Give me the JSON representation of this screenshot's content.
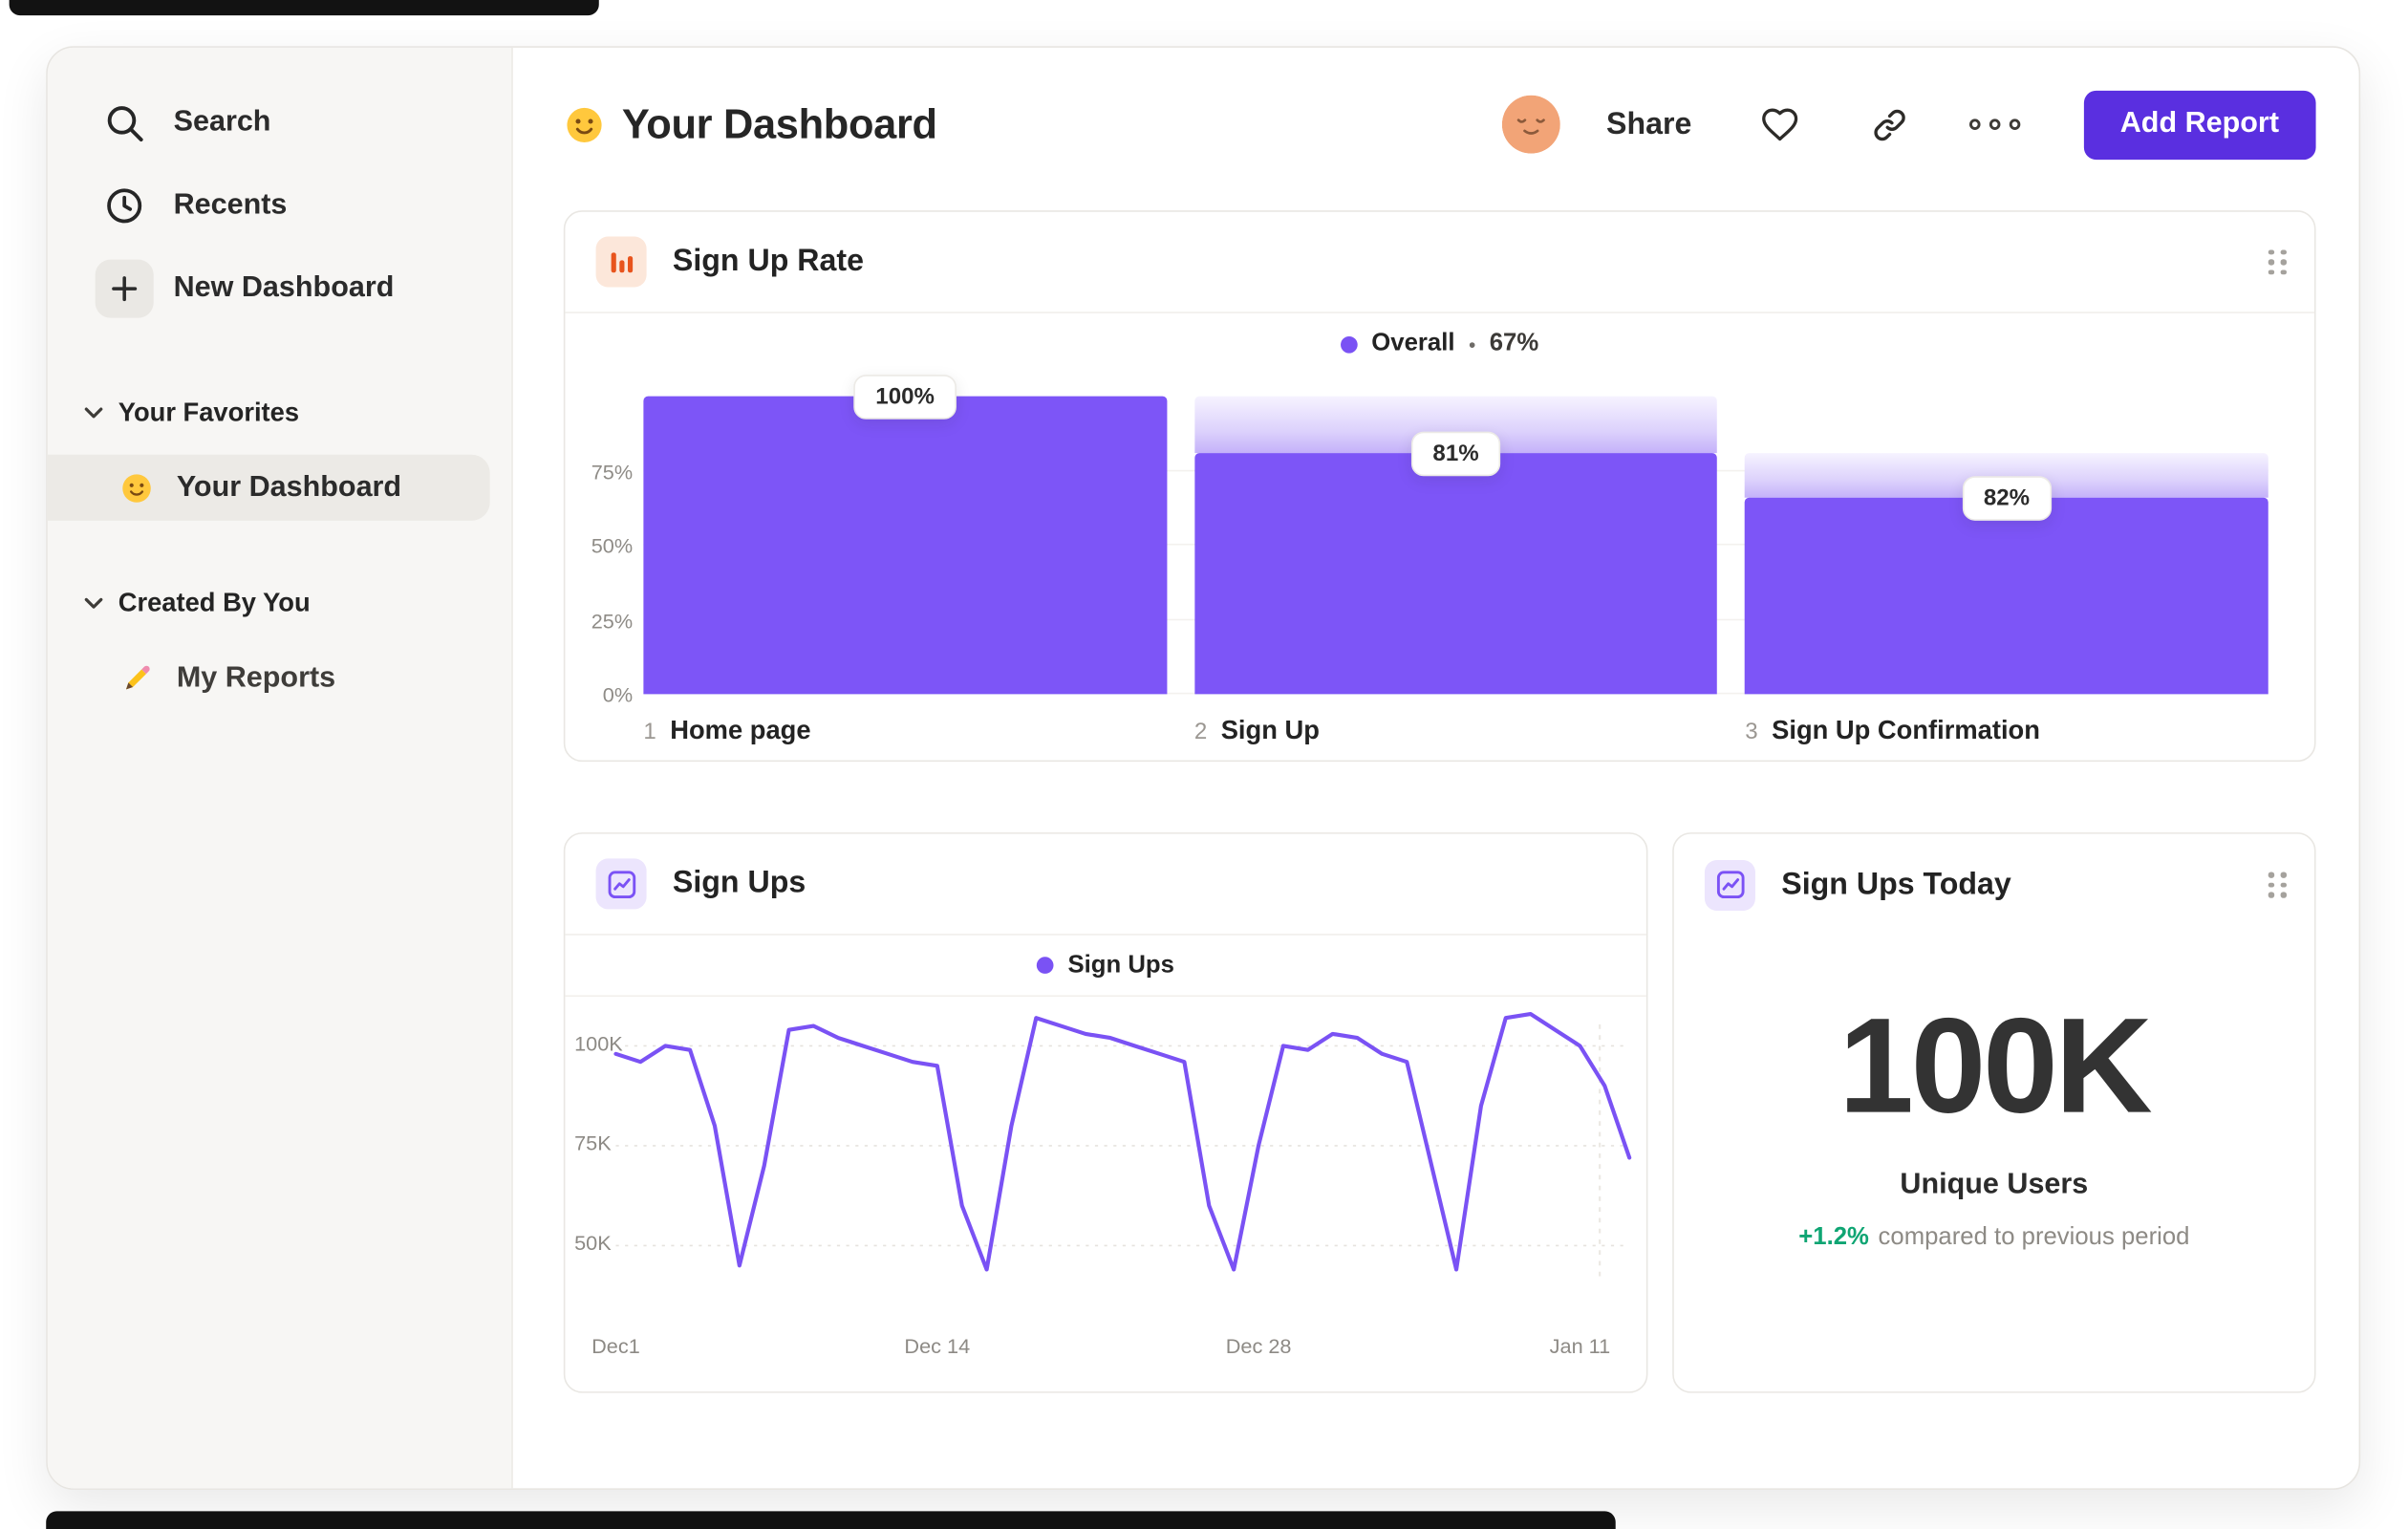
{
  "colors": {
    "accent": "#7A52F4",
    "bar_fill": "#7D55F7",
    "button": "#5A2FE0",
    "positive": "#0FA573",
    "icon_orange": "#E8541D"
  },
  "sidebar": {
    "search_label": "Search",
    "recents_label": "Recents",
    "new_dashboard_label": "New Dashboard",
    "favorites_title": "Your Favorites",
    "favorites_items": [
      {
        "label": "Your Dashboard",
        "icon": "smiley-icon",
        "selected": true
      }
    ],
    "created_title": "Created By You",
    "created_items": [
      {
        "label": "My Reports",
        "icon": "pencil-icon",
        "selected": false
      }
    ]
  },
  "header": {
    "title": "Your Dashboard",
    "title_icon": "smiley-icon",
    "avatar_icon": "relieved-face-icon",
    "share_label": "Share",
    "add_report_label": "Add Report"
  },
  "chart_data": [
    {
      "type": "bar",
      "variant": "funnel",
      "title": "Sign Up Rate",
      "legend": {
        "label": "Overall",
        "sep": "•",
        "value": "67%"
      },
      "ylim": [
        0,
        100
      ],
      "y_ticks": [
        {
          "label": "75%",
          "pct": 75
        },
        {
          "label": "50%",
          "pct": 50
        },
        {
          "label": "25%",
          "pct": 25
        },
        {
          "label": "0%",
          "pct": 0
        }
      ],
      "steps": [
        {
          "num": "1",
          "label": "Home page",
          "value_label": "100%",
          "solid_pct": 100,
          "ghost_pct": 100
        },
        {
          "num": "2",
          "label": "Sign Up",
          "value_label": "81%",
          "solid_pct": 81,
          "ghost_pct": 100
        },
        {
          "num": "3",
          "label": "Sign Up Confirmation",
          "value_label": "82%",
          "solid_pct": 66,
          "ghost_pct": 81
        }
      ]
    },
    {
      "type": "line",
      "title": "Sign Ups",
      "legend": {
        "label": "Sign Ups"
      },
      "unit": "K",
      "ylim_k": [
        40,
        112
      ],
      "y_ticks": [
        {
          "label": "100K",
          "value": 100
        },
        {
          "label": "75K",
          "value": 75
        },
        {
          "label": "50K",
          "value": 50
        }
      ],
      "x_ticks": [
        {
          "label": "Dec1",
          "day": 0
        },
        {
          "label": "Dec 14",
          "day": 13
        },
        {
          "label": "Dec 28",
          "day": 26
        },
        {
          "label": "Jan 11",
          "day": 39
        }
      ],
      "x_span_days": 41,
      "today_marker_day": 39.8,
      "values_k": [
        98,
        96,
        100,
        99,
        80,
        45,
        70,
        104,
        105,
        102,
        100,
        98,
        96,
        95,
        60,
        44,
        80,
        107,
        105,
        103,
        102,
        100,
        98,
        96,
        60,
        44,
        75,
        100,
        99,
        103,
        102,
        98,
        96,
        70,
        44,
        85,
        107,
        108,
        104,
        100,
        90,
        72
      ]
    },
    {
      "type": "metric",
      "title": "Sign Ups Today",
      "value": "100K",
      "label": "Unique Users",
      "delta": "+1.2%",
      "delta_note": "compared to previous period"
    }
  ]
}
